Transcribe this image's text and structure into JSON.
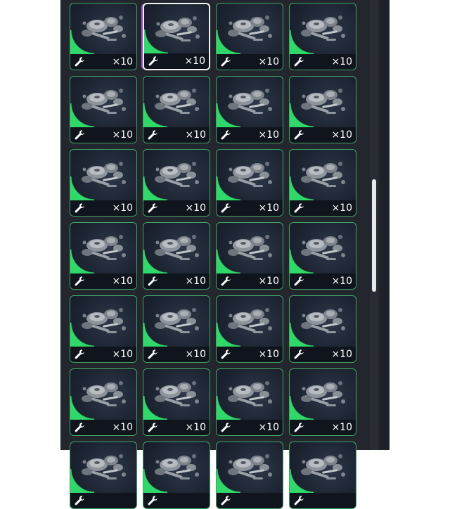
{
  "inventory": {
    "selected_index": 1,
    "slots": [
      {
        "item_icon": "mechanical-parts-icon",
        "type_icon": "wrench-icon",
        "count": "×10",
        "rarity_color": "#2fd868"
      },
      {
        "item_icon": "mechanical-parts-icon",
        "type_icon": "wrench-icon",
        "count": "×10",
        "rarity_color": "#2fd868"
      },
      {
        "item_icon": "mechanical-parts-icon",
        "type_icon": "wrench-icon",
        "count": "×10",
        "rarity_color": "#2fd868"
      },
      {
        "item_icon": "mechanical-parts-icon",
        "type_icon": "wrench-icon",
        "count": "×10",
        "rarity_color": "#2fd868"
      },
      {
        "item_icon": "mechanical-parts-icon",
        "type_icon": "wrench-icon",
        "count": "×10",
        "rarity_color": "#2fd868"
      },
      {
        "item_icon": "mechanical-parts-icon",
        "type_icon": "wrench-icon",
        "count": "×10",
        "rarity_color": "#2fd868"
      },
      {
        "item_icon": "mechanical-parts-icon",
        "type_icon": "wrench-icon",
        "count": "×10",
        "rarity_color": "#2fd868"
      },
      {
        "item_icon": "mechanical-parts-icon",
        "type_icon": "wrench-icon",
        "count": "×10",
        "rarity_color": "#2fd868"
      },
      {
        "item_icon": "mechanical-parts-icon",
        "type_icon": "wrench-icon",
        "count": "×10",
        "rarity_color": "#2fd868"
      },
      {
        "item_icon": "mechanical-parts-icon",
        "type_icon": "wrench-icon",
        "count": "×10",
        "rarity_color": "#2fd868"
      },
      {
        "item_icon": "mechanical-parts-icon",
        "type_icon": "wrench-icon",
        "count": "×10",
        "rarity_color": "#2fd868"
      },
      {
        "item_icon": "mechanical-parts-icon",
        "type_icon": "wrench-icon",
        "count": "×10",
        "rarity_color": "#2fd868"
      },
      {
        "item_icon": "mechanical-parts-icon",
        "type_icon": "wrench-icon",
        "count": "×10",
        "rarity_color": "#2fd868"
      },
      {
        "item_icon": "mechanical-parts-icon",
        "type_icon": "wrench-icon",
        "count": "×10",
        "rarity_color": "#2fd868"
      },
      {
        "item_icon": "mechanical-parts-icon",
        "type_icon": "wrench-icon",
        "count": "×10",
        "rarity_color": "#2fd868"
      },
      {
        "item_icon": "mechanical-parts-icon",
        "type_icon": "wrench-icon",
        "count": "×10",
        "rarity_color": "#2fd868"
      },
      {
        "item_icon": "mechanical-parts-icon",
        "type_icon": "wrench-icon",
        "count": "×10",
        "rarity_color": "#2fd868"
      },
      {
        "item_icon": "mechanical-parts-icon",
        "type_icon": "wrench-icon",
        "count": "×10",
        "rarity_color": "#2fd868"
      },
      {
        "item_icon": "mechanical-parts-icon",
        "type_icon": "wrench-icon",
        "count": "×10",
        "rarity_color": "#2fd868"
      },
      {
        "item_icon": "mechanical-parts-icon",
        "type_icon": "wrench-icon",
        "count": "×10",
        "rarity_color": "#2fd868"
      },
      {
        "item_icon": "mechanical-parts-icon",
        "type_icon": "wrench-icon",
        "count": "×10",
        "rarity_color": "#2fd868"
      },
      {
        "item_icon": "mechanical-parts-icon",
        "type_icon": "wrench-icon",
        "count": "×10",
        "rarity_color": "#2fd868"
      },
      {
        "item_icon": "mechanical-parts-icon",
        "type_icon": "wrench-icon",
        "count": "×10",
        "rarity_color": "#2fd868"
      },
      {
        "item_icon": "mechanical-parts-icon",
        "type_icon": "wrench-icon",
        "count": "×10",
        "rarity_color": "#2fd868"
      },
      {
        "item_icon": "mechanical-parts-icon",
        "type_icon": "wrench-icon",
        "count": "",
        "rarity_color": "#2fd868"
      },
      {
        "item_icon": "mechanical-parts-icon",
        "type_icon": "wrench-icon",
        "count": "",
        "rarity_color": "#2fd868"
      },
      {
        "item_icon": "mechanical-parts-icon",
        "type_icon": "wrench-icon",
        "count": "",
        "rarity_color": "#2fd868"
      },
      {
        "item_icon": "mechanical-parts-icon",
        "type_icon": "wrench-icon",
        "count": "",
        "rarity_color": "#2fd868"
      }
    ]
  },
  "scrollbar": {
    "position_fraction": 0.52
  },
  "colors": {
    "panel_bg": "#24262e",
    "slot_border": "#3fa565",
    "selected_border": "#f4f4f4",
    "rarity": "#2fd868"
  }
}
